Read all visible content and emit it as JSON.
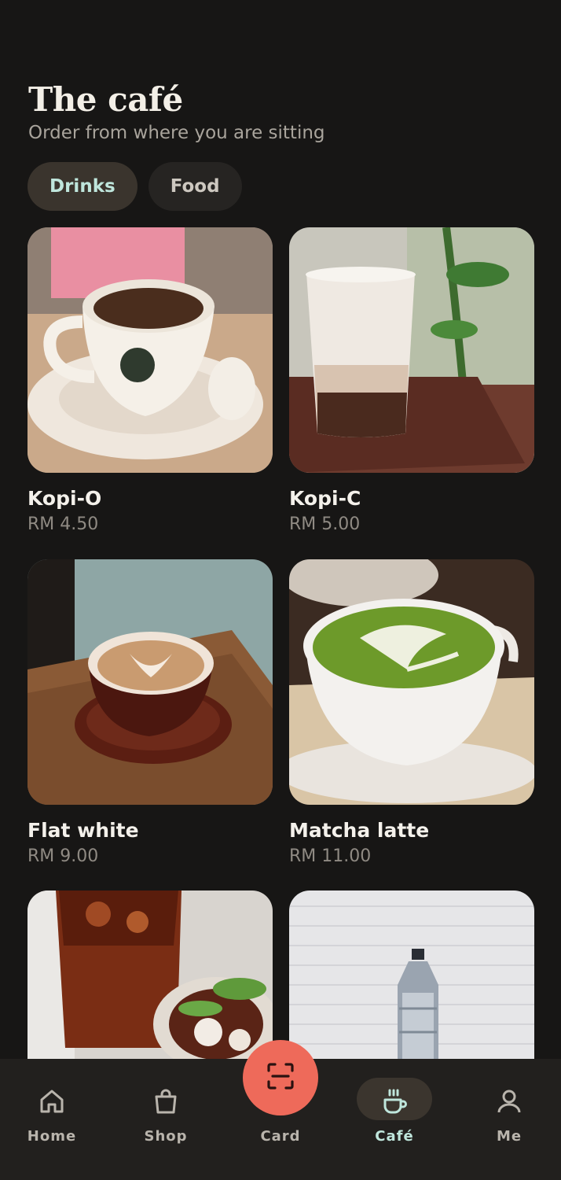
{
  "header": {
    "title": "The café",
    "subtitle": "Order from where you are sitting"
  },
  "tabs": [
    {
      "label": "Drinks",
      "active": true
    },
    {
      "label": "Food",
      "active": false
    }
  ],
  "items": [
    {
      "name": "Kopi-O",
      "price": "RM 4.50"
    },
    {
      "name": "Kopi-C",
      "price": "RM 5.00"
    },
    {
      "name": "Flat white",
      "price": "RM 9.00"
    },
    {
      "name": "Matcha latte",
      "price": "RM 11.00"
    },
    {
      "name": "",
      "price": ""
    },
    {
      "name": "",
      "price": ""
    }
  ],
  "nav": {
    "items": [
      {
        "label": "Home",
        "icon": "home-icon",
        "active": false
      },
      {
        "label": "Shop",
        "icon": "bag-icon",
        "active": false
      },
      {
        "label": "Card",
        "icon": "scan-icon",
        "active": false
      },
      {
        "label": "Café",
        "icon": "coffee-cup-icon",
        "active": true
      },
      {
        "label": "Me",
        "icon": "person-icon",
        "active": false
      }
    ]
  },
  "colors": {
    "background": "#171615",
    "accent_mint": "#bfe6dc",
    "fab_coral": "#ee6a5a"
  }
}
